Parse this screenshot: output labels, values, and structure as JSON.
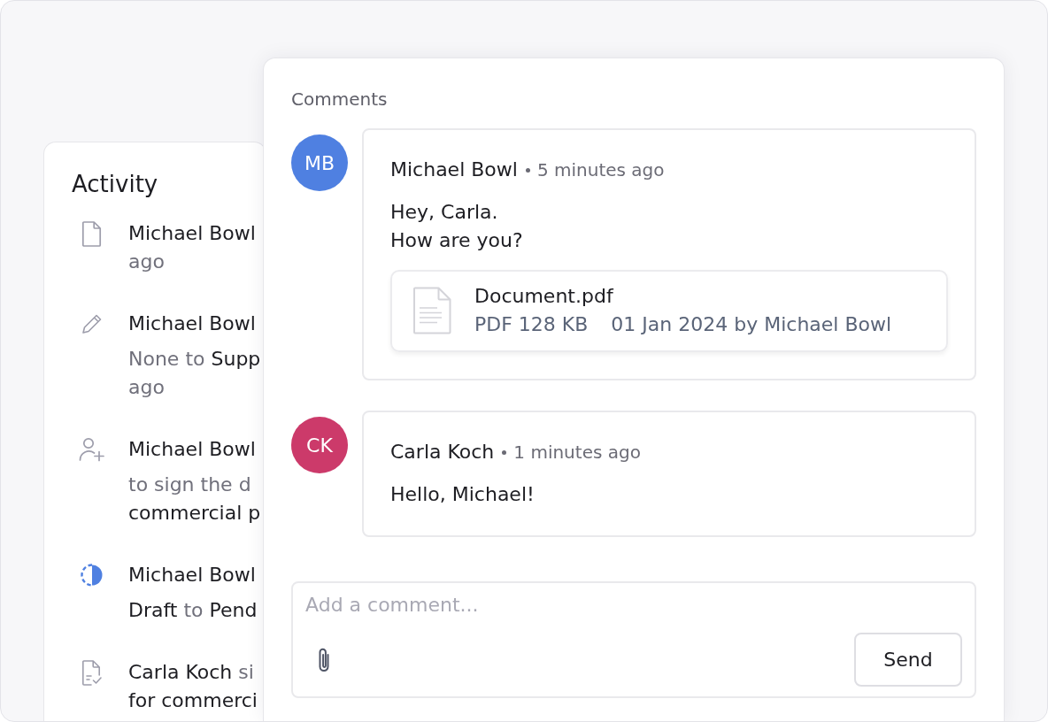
{
  "activity": {
    "title": "Activity",
    "items": [
      {
        "kind": "created",
        "paragraphs": [
          [
            [
              {
                "text": "Michael Bowl",
                "highlight": true
              }
            ],
            [
              {
                "text": "ago",
                "highlight": false
              }
            ]
          ]
        ]
      },
      {
        "kind": "edited",
        "paragraphs": [
          [
            [
              {
                "text": "Michael Bowl",
                "highlight": true
              }
            ]
          ],
          [
            [
              {
                "text": "None to",
                "highlight": false
              },
              {
                "text": "Supp",
                "highlight": true
              }
            ],
            [
              {
                "text": "ago",
                "highlight": false
              }
            ]
          ]
        ]
      },
      {
        "kind": "invited",
        "paragraphs": [
          [
            [
              {
                "text": "Michael Bowl",
                "highlight": true
              }
            ]
          ],
          [
            [
              {
                "text": "to sign the d",
                "highlight": false
              }
            ],
            [
              {
                "text": "commercial p",
                "highlight": true
              }
            ]
          ]
        ]
      },
      {
        "kind": "status",
        "paragraphs": [
          [
            [
              {
                "text": "Michael Bowl",
                "highlight": true
              }
            ]
          ],
          [
            [
              {
                "text": "Draft",
                "highlight": true
              },
              {
                "text": "to",
                "highlight": false
              },
              {
                "text": "Pend",
                "highlight": true
              }
            ]
          ]
        ]
      },
      {
        "kind": "signed",
        "paragraphs": [
          [
            [
              {
                "text": "Carla Koch",
                "highlight": true
              },
              {
                "text": "si",
                "highlight": false
              }
            ],
            [
              {
                "text": "for commerci",
                "highlight": true
              }
            ]
          ]
        ]
      }
    ]
  },
  "comments": {
    "title": "Comments",
    "items": [
      {
        "initials": "MB",
        "color": "#4f80e1",
        "author": "Michael Bowl",
        "time": "5 minutes ago",
        "body": [
          "Hey, Carla.",
          "How are you?"
        ],
        "attachments": [
          {
            "file_name": "Document.pdf",
            "size": "PDF 128 KB",
            "details": "01 Jan 2024 by Michael Bowl"
          }
        ]
      },
      {
        "initials": "CK",
        "color": "#cc3a6a",
        "author": "Carla Koch",
        "time": "1 minutes ago",
        "body": [
          "Hello, Michael!"
        ]
      }
    ]
  },
  "composer": {
    "placeholder": "Add a comment...",
    "button": "Send"
  }
}
